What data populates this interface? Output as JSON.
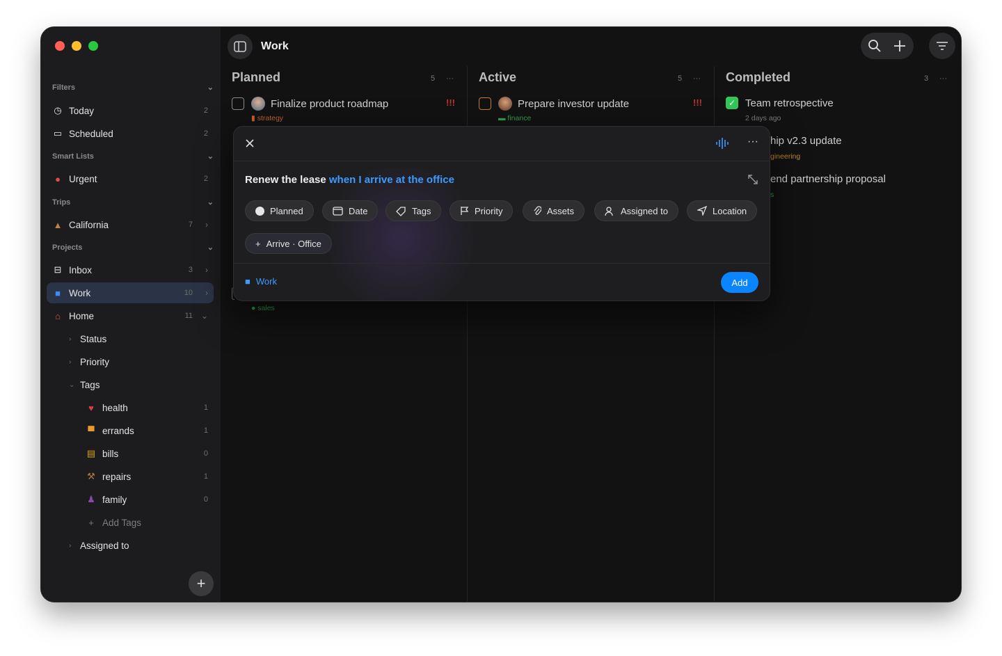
{
  "window": {
    "title": "Work",
    "traffic_colors": [
      "#ff5f57",
      "#febc2e",
      "#28c840"
    ]
  },
  "sidebar": {
    "sections": {
      "filters": "Filters",
      "smart_lists": "Smart Lists",
      "trips": "Trips",
      "projects": "Projects"
    },
    "items": {
      "today": {
        "label": "Today",
        "count": "2"
      },
      "scheduled": {
        "label": "Scheduled",
        "count": "2"
      },
      "urgent": {
        "label": "Urgent",
        "count": "2"
      },
      "california": {
        "label": "California",
        "count": "7"
      },
      "inbox": {
        "label": "Inbox",
        "count": "3"
      },
      "work": {
        "label": "Work",
        "count": "10"
      },
      "home": {
        "label": "Home",
        "count": "11"
      },
      "status": {
        "label": "Status"
      },
      "priority": {
        "label": "Priority"
      },
      "tags": {
        "label": "Tags"
      },
      "health": {
        "label": "health",
        "count": "1"
      },
      "errands": {
        "label": "errands",
        "count": "1"
      },
      "bills": {
        "label": "bills",
        "count": "0"
      },
      "repairs": {
        "label": "repairs",
        "count": "1"
      },
      "family": {
        "label": "family",
        "count": "0"
      },
      "add_tags": {
        "label": "Add Tags"
      },
      "assigned_to": {
        "label": "Assigned to"
      }
    }
  },
  "columns": {
    "planned": {
      "title": "Planned",
      "count": "5",
      "menu": "···"
    },
    "active": {
      "title": "Active",
      "count": "5",
      "menu": "···"
    },
    "completed": {
      "title": "Completed",
      "count": "3",
      "menu": "···"
    }
  },
  "tasks": {
    "roadmap": {
      "title": "Finalize product roadmap",
      "tag": "strategy",
      "priority": "!!!"
    },
    "investor": {
      "title": "Prepare investor update",
      "tag": "finance",
      "priority": "!!!"
    },
    "retro": {
      "title": "Team retrospective",
      "meta": "2 days ago"
    },
    "ship": {
      "title": "hip v2.3 update",
      "tag": "gineering"
    },
    "partnership": {
      "title": "end partnership proposal",
      "tag": "s"
    },
    "hidden_sales": {
      "tag": "sales"
    }
  },
  "dialog": {
    "title_plain": "Renew the lease ",
    "title_highlight": "when I arrive at the office",
    "chips": {
      "planned": "Planned",
      "date": "Date",
      "tags": "Tags",
      "priority": "Priority",
      "assets": "Assets",
      "assigned": "Assigned to",
      "location": "Location",
      "arrive": "Arrive · Office"
    },
    "project": "Work",
    "add_label": "Add",
    "accent": "#0a84ff"
  }
}
